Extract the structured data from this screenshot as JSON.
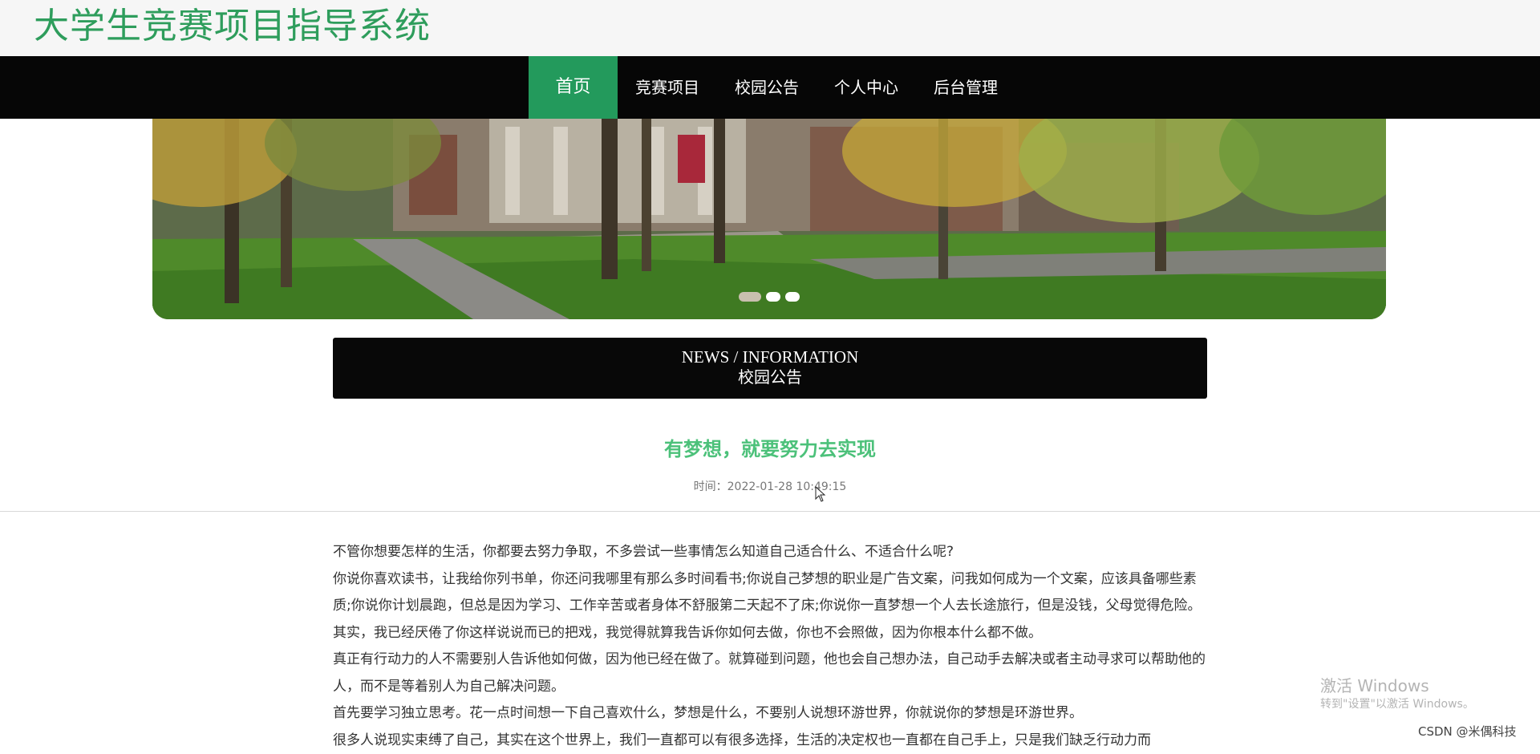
{
  "header": {
    "site_title": "大学生竞赛项目指导系统"
  },
  "nav": {
    "items": [
      {
        "label": "首页",
        "active": true
      },
      {
        "label": "竞赛项目"
      },
      {
        "label": "校园公告"
      },
      {
        "label": "个人中心"
      },
      {
        "label": "后台管理"
      }
    ]
  },
  "banner": {
    "slide_count": 3,
    "active_slide": 1
  },
  "news_header": {
    "title_en": "NEWS / INFORMATION",
    "title_cn": "校园公告"
  },
  "article": {
    "title": "有梦想，就要努力去实现",
    "time": "时间：2022-01-28 10:49:15",
    "paragraphs": [
      "不管你想要怎样的生活，你都要去努力争取，不多尝试一些事情怎么知道自己适合什么、不适合什么呢?",
      "你说你喜欢读书，让我给你列书单，你还问我哪里有那么多时间看书;你说自己梦想的职业是广告文案，问我如何成为一个文案，应该具备哪些素质;你说你计划晨跑，但总是因为学习、工作辛苦或者身体不舒服第二天起不了床;你说你一直梦想一个人去长途旅行，但是没钱，父母觉得危险。其实，我已经厌倦了你这样说说而已的把戏，我觉得就算我告诉你如何去做，你也不会照做，因为你根本什么都不做。",
      "真正有行动力的人不需要别人告诉他如何做，因为他已经在做了。就算碰到问题，他也会自己想办法，自己动手去解决或者主动寻求可以帮助他的人，而不是等着别人为自己解决问题。",
      "首先要学习独立思考。花一点时间想一下自己喜欢什么，梦想是什么，不要别人说想环游世界，你就说你的梦想是环游世界。",
      "很多人说现实束缚了自己，其实在这个世界上，我们一直都可以有很多选择，生活的决定权也一直都在自己手上，只是我们缺乏行动力而"
    ]
  },
  "watermark": {
    "title": "激活 Windows",
    "subtitle": "转到\"设置\"以激活 Windows。"
  },
  "credit": "CSDN @米偶科技"
}
